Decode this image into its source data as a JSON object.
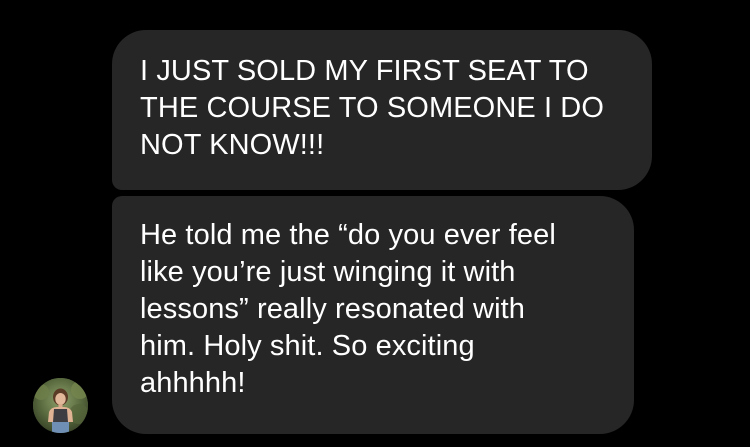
{
  "conversation": {
    "messages": [
      {
        "sender": "other",
        "text": "I JUST SOLD MY FIRST SEAT TO\nTHE COURSE TO SOMEONE I DO\nNOT KNOW!!!"
      },
      {
        "sender": "other",
        "text": "He told me the “do you ever feel\nlike you’re just winging it with\nlessons” really resonated with\nhim.  Holy shit. So exciting\nahhhhh!"
      }
    ],
    "avatar_icon": "profile-photo-avatar"
  },
  "colors": {
    "background": "#000000",
    "bubble": "#262626",
    "text": "#ffffff"
  }
}
